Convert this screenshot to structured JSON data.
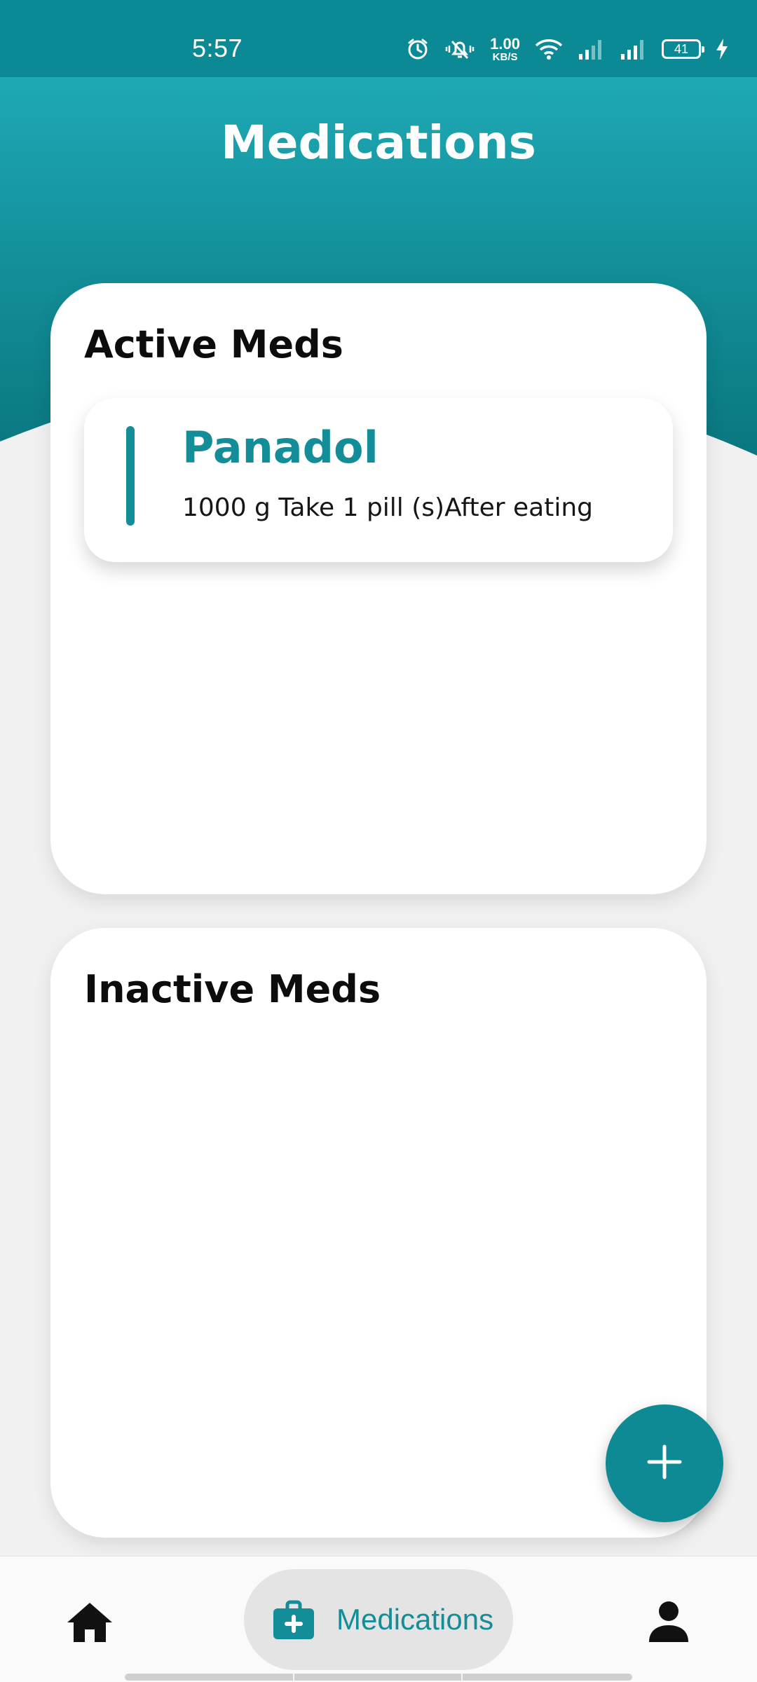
{
  "status_bar": {
    "time": "5:57",
    "net_speed_value": "1.00",
    "net_speed_unit": "KB/S",
    "battery_level": "41",
    "icons": [
      "alarm-icon",
      "muted-bell-icon",
      "wifi-icon",
      "signal-icon",
      "signal-icon",
      "battery-icon",
      "charging-icon"
    ]
  },
  "header": {
    "title": "Medications"
  },
  "active_section": {
    "title": "Active Meds",
    "items": [
      {
        "name": "Panadol",
        "description": "1000 g Take 1 pill (s)After eating"
      }
    ]
  },
  "inactive_section": {
    "title": "Inactive Meds",
    "items": []
  },
  "fab": {
    "icon": "plus-icon"
  },
  "bottom_nav": {
    "items": [
      {
        "icon": "home-icon",
        "label": ""
      },
      {
        "icon": "medical-briefcase-icon",
        "label": "Medications",
        "active": true
      },
      {
        "icon": "person-icon",
        "label": ""
      }
    ]
  },
  "colors": {
    "primary": "#138d98",
    "header_top": "#1ea8b4",
    "header_bottom": "#0b7b84"
  }
}
